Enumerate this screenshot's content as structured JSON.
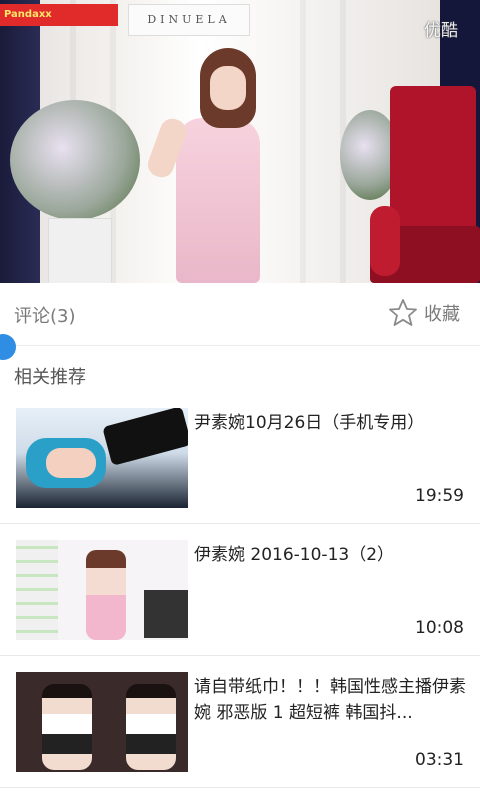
{
  "player": {
    "badge": "Pandaxx",
    "sign_text": "DINUELA",
    "watermark": "优酷"
  },
  "action_bar": {
    "comments_label": "评论(3)",
    "favorite_label": "收藏"
  },
  "section": {
    "title": "相关推荐"
  },
  "related": [
    {
      "title": "尹素婉10月26日（手机专用）",
      "duration": "19:59"
    },
    {
      "title": "伊素婉 2016-10-13（2）",
      "duration": "10:08"
    },
    {
      "title": "请自带纸巾！！！韩国性感主播伊素婉 邪恶版 1 超短裤 韩国抖...",
      "duration": "03:31"
    }
  ],
  "colors": {
    "accent_blue": "#2f8de4",
    "text_gray": "#7a7a7a"
  }
}
